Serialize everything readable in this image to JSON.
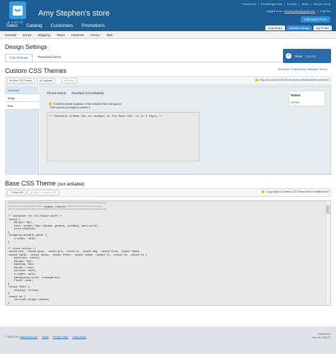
{
  "header": {
    "logo_text": "ecwid",
    "store_title": "Amy Stephen's store",
    "top_links": [
      "Ecwid.com",
      "Knowledge base",
      "Forums",
      "Ideas",
      "Report a Bug"
    ],
    "logged_in_prefix": "Logged in as",
    "email": "amystephen@gmail.com",
    "logout": "Log Out",
    "visit_button": "Visit Store Front",
    "main_nav": [
      "Sales",
      "Catalog",
      "Customers",
      "Promotions"
    ],
    "right_tabs": [
      "Dashboard",
      "System settings",
      "My Profile"
    ]
  },
  "subnav": [
    "General",
    "Zones",
    "Shipping",
    "Taxes",
    "Payment",
    "Design",
    "Mail"
  ],
  "page_title": "Design Settings",
  "tabs": [
    "CSS Themes",
    "Thumbnail Sizes"
  ],
  "save": {
    "label": "Save",
    "state": "(Saved)"
  },
  "custom": {
    "title": "Custom CSS Themes",
    "help_prefix": "Need help?",
    "help_link": "Ecwid Design Integration Service",
    "toolbar": [
      "New CSS Theme",
      "Duplicate",
      "Delete"
    ],
    "only_one_tip": "Only one custom CSS theme can be activated at the same time",
    "themes": [
      "Standard",
      "Beige",
      "Red"
    ],
    "theme_name_label": "Theme Name",
    "theme_name_value": "Standard (not editable)",
    "info_line1": "To edit this theme Duplicate it, then editable theme will appear.",
    "info_line2": "Edit it and do not forget to activate it.",
    "css_placeholder": "/* Standard scheme has no changes to the Base CSS, so it's empty */",
    "status_label": "Status",
    "status_value": "Active"
  },
  "base": {
    "title": "Base CSS Theme",
    "title_suffix": "(not editable)",
    "toolbar": [
      "Select All",
      "Copy to Custom CSS"
    ],
    "copy_tip": "Copy styles to Custom CSS Theme field to redefine them",
    "code": "/*************************************************************/\n/********************* Common classes *********************/\n/*************************************************************/\n\n/* Container for all Ecwid stuff */\n.ecwid {\n    margin: 0px;\n    font: normal 13px tahoma, geneva, verdana, sans-serif;\n    color:#1e1e1e;\n}\n.dragdrop-movable-panel {\n    z-index: 1010;\n}\n\n/* clear styles */\n.ecwid div, .ecwid span, .ecwid pre, .ecwid a, .ecwid img, .ecwid form, .ecwid label,\n.ecwid table, .ecwid tbody, .ecwid tfoot, .ecwid thead, .ecwid tr, .ecwid th, .ecwid td {\n    position: static;\n    margin: 0px;\n    padding: 0px;\n    border: none;\n    outline: none;\n    z-index: auto;\n    background-color: transparent;\n    float: none;\n}\n.ecwid label {\n    display: inline;\n}\n.ecwid td {\n    vertical-align: middle;\n}"
  },
  "footer": {
    "copyright": "© 2009-2010 ",
    "copyright_link": "www.ecwid.com",
    "links": [
      "Terms",
      "Privacy Policy",
      "Ecwid Home"
    ],
    "version": "Version 5.x",
    "store_id": "Store ID: 245176"
  }
}
